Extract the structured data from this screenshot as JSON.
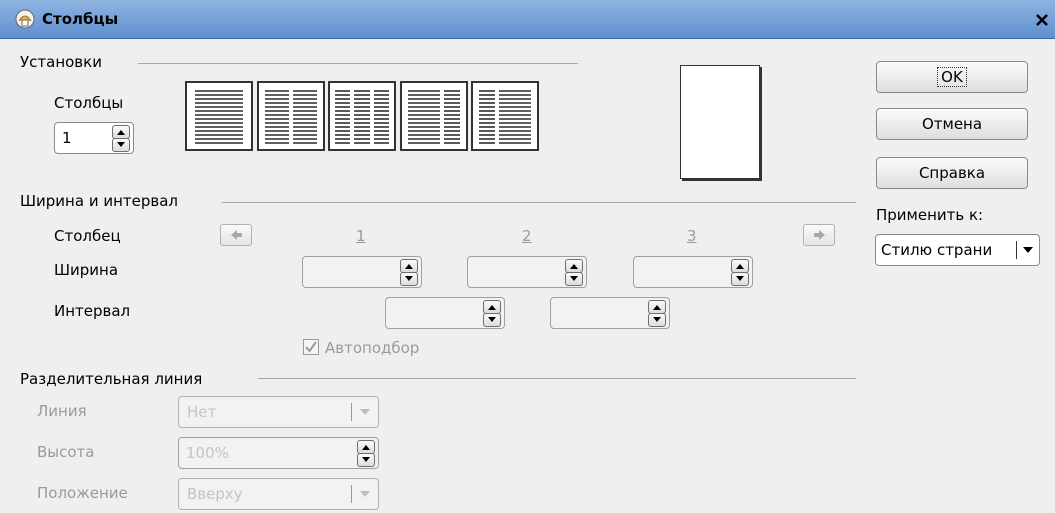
{
  "window": {
    "title": "Столбцы"
  },
  "settings": {
    "section_label": "Установки",
    "columns_label": "Столбцы",
    "columns_value": "1",
    "presets": [
      "preset-1",
      "preset-2",
      "preset-3",
      "preset-4",
      "preset-5"
    ]
  },
  "width_spacing": {
    "section_label": "Ширина и интервал",
    "column_label": "Столбец",
    "column_numbers": [
      "1",
      "2",
      "3"
    ],
    "width_label": "Ширина",
    "spacing_label": "Интервал",
    "autowidth_label": "Автоподбор",
    "autowidth_checked": true
  },
  "separator": {
    "section_label": "Разделительная линия",
    "line_label": "Линия",
    "line_value": "Нет",
    "height_label": "Высота",
    "height_value": "100%",
    "position_label": "Положение",
    "position_value": "Вверху"
  },
  "buttons": {
    "ok": "OK",
    "cancel": "Отмена",
    "help": "Справка"
  },
  "apply": {
    "label": "Применить к:",
    "value": "Стилю страни"
  }
}
